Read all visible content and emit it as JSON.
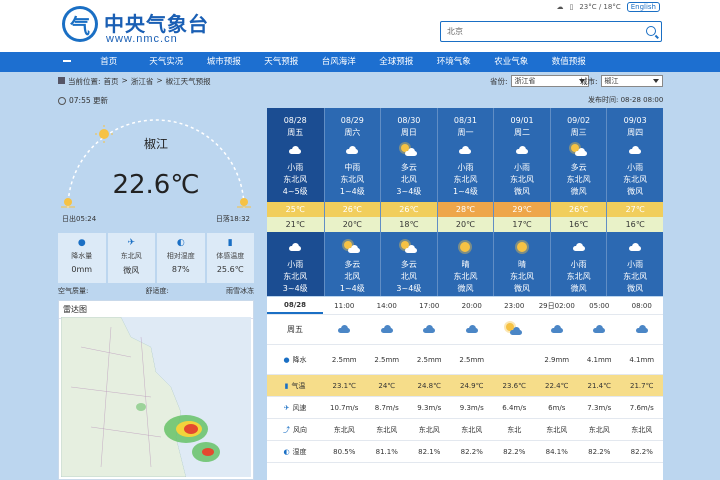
{
  "header": {
    "site_name": "中央气象台",
    "site_url": "www.nmc.cn",
    "logo_glyph": "气",
    "topbar": {
      "weather_text": "23°C / 18°C",
      "lang_label": "English"
    },
    "search": {
      "value": "北京"
    }
  },
  "nav": {
    "items": [
      "首页",
      "天气实况",
      "城市预报",
      "天气预报",
      "台风海洋",
      "全球预报",
      "环境气象",
      "农业气象",
      "数值预报"
    ]
  },
  "breadcrumb": {
    "label": "当前位置:",
    "items": [
      "首页",
      "浙江省",
      "椒江天气预报"
    ]
  },
  "province": {
    "label": "省份:",
    "value": "浙江省"
  },
  "city_select": {
    "label": "城市:",
    "value": "椒江"
  },
  "published": "07:55 更新",
  "current": {
    "city": "椒江",
    "temperature": "22.6℃",
    "sunrise": "日出05:24",
    "sunset": "日落18:32"
  },
  "stats": [
    {
      "icon": "rain-drop-icon",
      "label": "降水量",
      "value": "0mm"
    },
    {
      "icon": "wind-icon",
      "label": "东北风",
      "value": "微风"
    },
    {
      "icon": "humidity-icon",
      "label": "相对湿度",
      "value": "87%"
    },
    {
      "icon": "thermometer-icon",
      "label": "体感温度",
      "value": "25.6℃"
    }
  ],
  "air_quality": {
    "aqi_label": "空气质量:",
    "comfort_label": "舒适度:",
    "warning_label": "雨雪冰冻"
  },
  "radar": {
    "title": "雷达图"
  },
  "updated": "发布时间: 08-28 08:00",
  "forecast": [
    {
      "date": "08/28",
      "week": "周五",
      "day_icon": "cloud",
      "day_weather": "小雨",
      "day_wind_dir": "东北风",
      "day_wind": "4~5级",
      "hi": "25℃",
      "lo": "21℃",
      "night_icon": "cloud",
      "night_weather": "小雨",
      "night_wind_dir": "东北风",
      "night_wind": "3~4级",
      "hi_color": "#f1ce5c"
    },
    {
      "date": "08/29",
      "week": "周六",
      "day_icon": "cloud",
      "day_weather": "中雨",
      "day_wind_dir": "东北风",
      "day_wind": "1~4级",
      "hi": "26℃",
      "lo": "20℃",
      "night_icon": "suncloud",
      "night_weather": "多云",
      "night_wind_dir": "北风",
      "night_wind": "1~4级",
      "hi_color": "#f1ce5c"
    },
    {
      "date": "08/30",
      "week": "周日",
      "day_icon": "suncloud",
      "day_weather": "多云",
      "day_wind_dir": "北风",
      "day_wind": "3~4级",
      "hi": "26℃",
      "lo": "18℃",
      "night_icon": "suncloud",
      "night_weather": "多云",
      "night_wind_dir": "北风",
      "night_wind": "3~4级",
      "hi_color": "#f1ce5c"
    },
    {
      "date": "08/31",
      "week": "周一",
      "day_icon": "cloud",
      "day_weather": "小雨",
      "day_wind_dir": "东北风",
      "day_wind": "1~4级",
      "hi": "28℃",
      "lo": "20℃",
      "night_icon": "sun",
      "night_weather": "晴",
      "night_wind_dir": "东北风",
      "night_wind": "微风",
      "hi_color": "#eea64a"
    },
    {
      "date": "09/01",
      "week": "周二",
      "day_icon": "cloud",
      "day_weather": "小雨",
      "day_wind_dir": "东北风",
      "day_wind": "微风",
      "hi": "29℃",
      "lo": "17℃",
      "night_icon": "sun",
      "night_weather": "晴",
      "night_wind_dir": "东北风",
      "night_wind": "微风",
      "hi_color": "#eea64a"
    },
    {
      "date": "09/02",
      "week": "周三",
      "day_icon": "suncloud",
      "day_weather": "多云",
      "day_wind_dir": "东北风",
      "day_wind": "微风",
      "hi": "26℃",
      "lo": "16℃",
      "night_icon": "cloud",
      "night_weather": "小雨",
      "night_wind_dir": "东北风",
      "night_wind": "微风",
      "hi_color": "#f1ce5c"
    },
    {
      "date": "09/03",
      "week": "周四",
      "day_icon": "cloud",
      "day_weather": "小雨",
      "day_wind_dir": "东北风",
      "day_wind": "微风",
      "hi": "27℃",
      "lo": "16℃",
      "night_icon": "cloud",
      "night_weather": "小雨",
      "night_wind_dir": "东北风",
      "night_wind": "微风",
      "hi_color": "#f1ce5c"
    }
  ],
  "hourly": {
    "date": "08/28",
    "week": "周五",
    "times": [
      "11:00",
      "14:00",
      "17:00",
      "20:00",
      "23:00",
      "29日02:00",
      "05:00",
      "08:00"
    ],
    "icons": [
      "cloud",
      "cloud",
      "cloud",
      "cloud",
      "suncloud",
      "cloud",
      "cloud",
      "cloud"
    ],
    "rows": [
      {
        "icon": "rain-drop-icon",
        "label": "降水",
        "values": [
          "2.5mm",
          "2.5mm",
          "2.5mm",
          "2.5mm",
          "",
          "2.9mm",
          "4.1mm",
          "4.1mm"
        ]
      },
      {
        "icon": "thermometer-icon",
        "label": "气温",
        "values": [
          "23.1℃",
          "24℃",
          "24.8℃",
          "24.9℃",
          "23.6℃",
          "22.4℃",
          "21.4℃",
          "21.7℃"
        ]
      },
      {
        "icon": "wind-speed-icon",
        "label": "风速",
        "values": [
          "10.7m/s",
          "8.7m/s",
          "9.3m/s",
          "9.3m/s",
          "6.4m/s",
          "6m/s",
          "7.3m/s",
          "7.6m/s"
        ]
      },
      {
        "icon": "wind-icon",
        "label": "风向",
        "values": [
          "东北风",
          "东北风",
          "东北风",
          "东北风",
          "东北",
          "东北风",
          "东北风",
          "东北风"
        ]
      },
      {
        "icon": "humidity-icon",
        "label": "湿度",
        "values": [
          "80.5%",
          "81.1%",
          "82.1%",
          "82.2%",
          "82.2%",
          "84.1%",
          "82.2%",
          "82.2%"
        ]
      }
    ]
  }
}
